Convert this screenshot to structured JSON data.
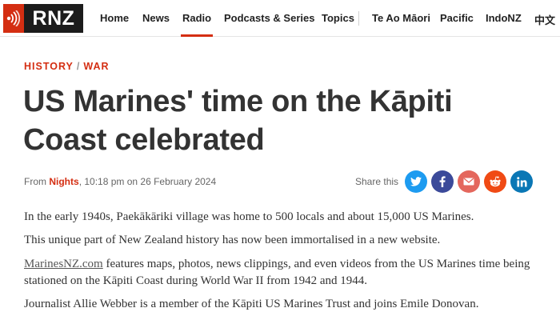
{
  "header": {
    "logo_text": "RNZ",
    "nav": [
      {
        "label": "Home"
      },
      {
        "label": "News"
      },
      {
        "label": "Radio"
      },
      {
        "label": "Podcasts & Series"
      },
      {
        "label": "Topics"
      },
      {
        "label": "Te Ao Māori"
      },
      {
        "label": "Pacific"
      },
      {
        "label": "IndoNZ"
      },
      {
        "label": "中文"
      }
    ],
    "active_nav": "Radio",
    "accent_color": "#d42e12"
  },
  "article": {
    "breadcrumb": [
      "HISTORY",
      "WAR"
    ],
    "breadcrumb_separator": "/",
    "title": "US Marines' time on the Kāpiti Coast celebrated",
    "byline": {
      "prefix": "From ",
      "program": "Nights",
      "timestamp": ", 10:18 pm on 26 February 2024"
    },
    "share": {
      "label": "Share this",
      "buttons": [
        {
          "icon": "twitter-icon",
          "color": "#1d9bf0"
        },
        {
          "icon": "facebook-icon",
          "color": "#3b4a9a"
        },
        {
          "icon": "email-icon",
          "color": "#e4675d"
        },
        {
          "icon": "reddit-icon",
          "color": "#f04a14"
        },
        {
          "icon": "linkedin-icon",
          "color": "#0a77b5"
        }
      ]
    },
    "paragraphs": {
      "p1": "In the early 1940s, Paekākāriki village was home to 500 locals and about 15,000 US Marines.",
      "p2": "This unique part of New Zealand history has now been immortalised in a new website.",
      "p3_link": "MarinesNZ.com",
      "p3_rest": " features maps, photos, news clippings, and even videos from the US Marines time being stationed on the Kāpiti Coast during World War II from 1942 and 1944.",
      "p4": "Journalist Allie Webber is a member of the Kāpiti US Marines Trust and joins Emile Donovan."
    }
  }
}
